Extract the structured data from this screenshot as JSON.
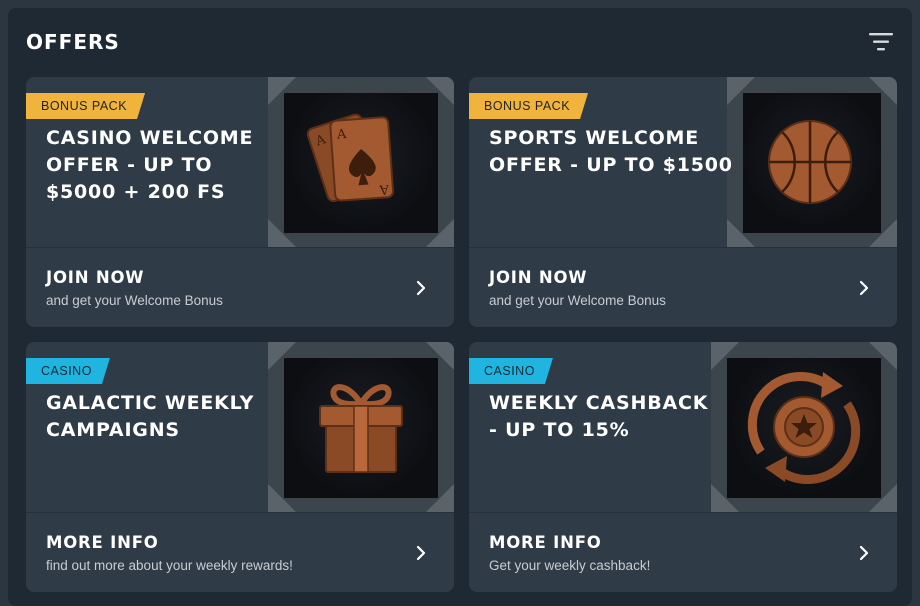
{
  "header": {
    "title": "OFFERS",
    "filter_icon": "filter-icon"
  },
  "colors": {
    "panel_bg": "#1e2933",
    "card_bg": "#2f3b46",
    "badge_gold": "#f0b43c",
    "badge_blue": "#20b4e0",
    "art_bronze": "#a45a30"
  },
  "offers": [
    {
      "badge": "BONUS PACK",
      "title": "CASINO WELCOME OFFER - UP TO $5000 + 200 FS",
      "image_icon": "playing-cards-icon",
      "cta_label": "JOIN NOW",
      "cta_sub": "and get your Welcome Bonus"
    },
    {
      "badge": "BONUS PACK",
      "title": "SPORTS WELCOME OFFER - UP TO $1500",
      "image_icon": "basketball-icon",
      "cta_label": "JOIN NOW",
      "cta_sub": "and get your Welcome Bonus"
    },
    {
      "badge": "CASINO",
      "title": "GALACTIC WEEKLY CAMPAIGNS",
      "image_icon": "gift-box-icon",
      "cta_label": "MORE INFO",
      "cta_sub": "find out more about your weekly rewards!"
    },
    {
      "badge": "CASINO",
      "title": "WEEKLY CASHBACK - UP TO 15%",
      "image_icon": "cashback-chip-icon",
      "cta_label": "MORE INFO",
      "cta_sub": "Get your weekly cashback!"
    }
  ]
}
